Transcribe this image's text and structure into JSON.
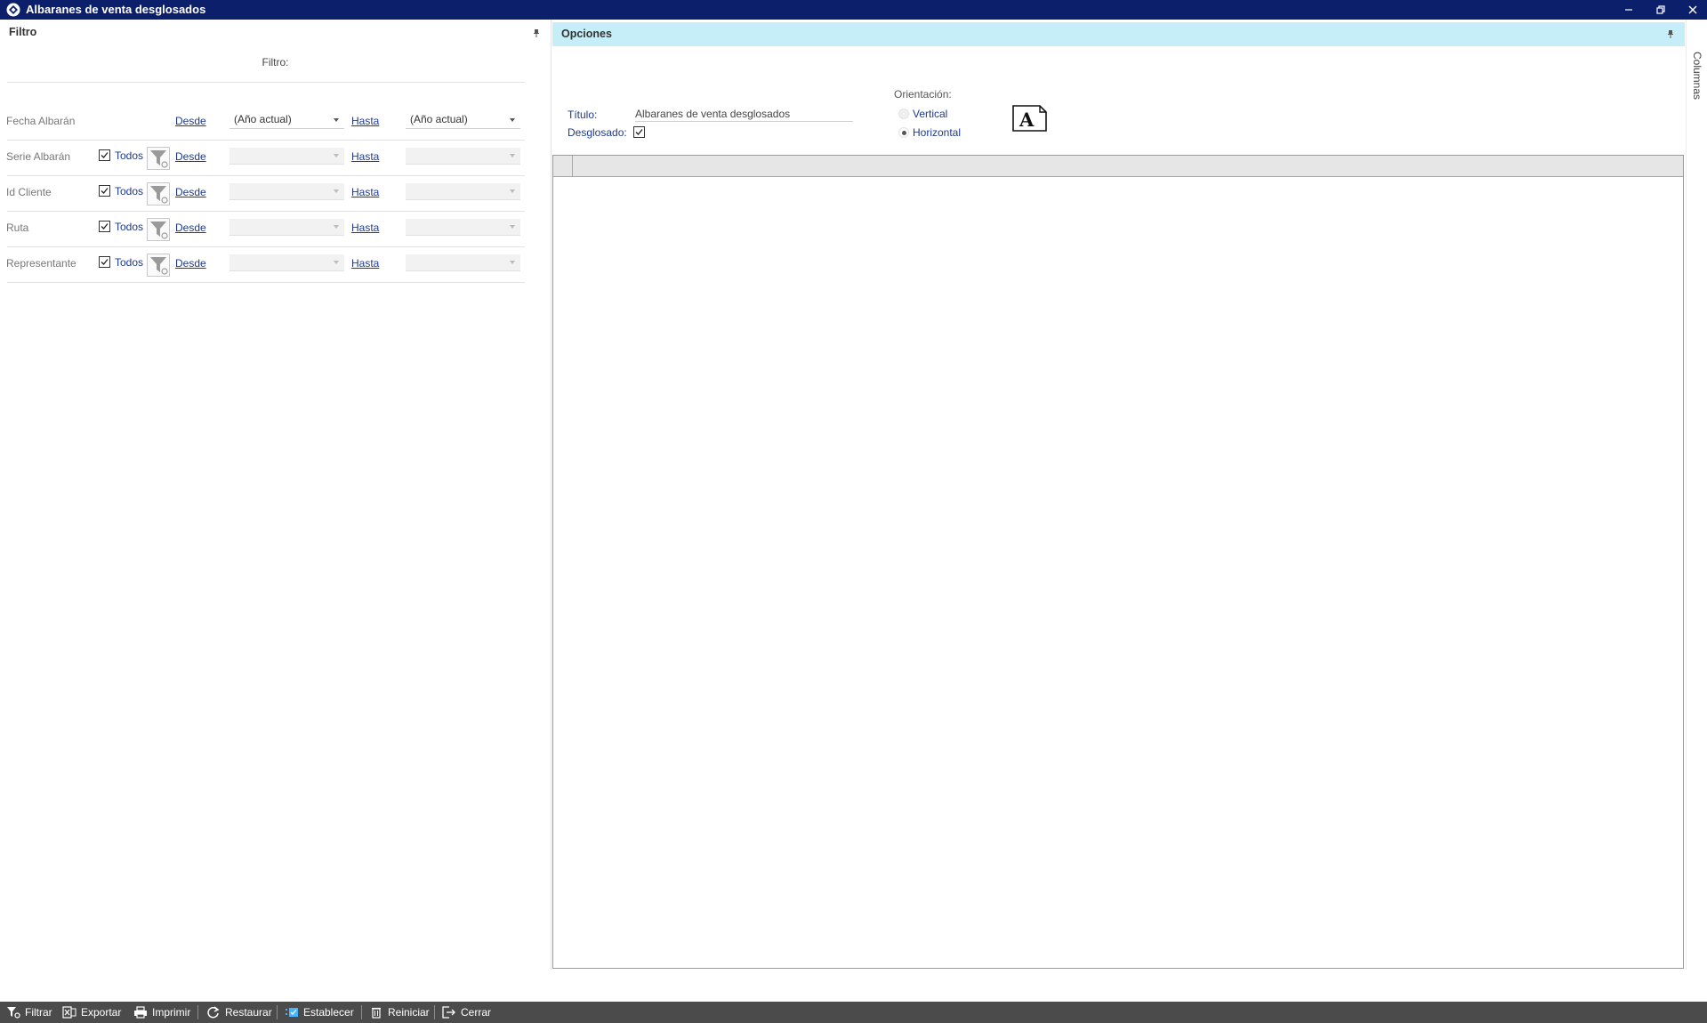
{
  "window": {
    "title": "Albaranes de venta desglosados",
    "controls": [
      "minimize",
      "restore",
      "close"
    ]
  },
  "filter_panel": {
    "header": "Filtro",
    "filter_label": "Filtro:",
    "rows": [
      {
        "label": "Fecha Albarán",
        "has_todos": false,
        "desde_link": "Desde",
        "desde_value": "(Año actual)",
        "hasta_link": "Hasta",
        "hasta_value": "(Año actual)"
      },
      {
        "label": "Serie Albarán",
        "has_todos": true,
        "todos_label": "Todos",
        "todos_checked": true,
        "desde_link": "Desde",
        "desde_value": "",
        "hasta_link": "Hasta",
        "hasta_value": ""
      },
      {
        "label": "Id Cliente",
        "has_todos": true,
        "todos_label": "Todos",
        "todos_checked": true,
        "desde_link": "Desde",
        "desde_value": "",
        "hasta_link": "Hasta",
        "hasta_value": ""
      },
      {
        "label": "Ruta",
        "has_todos": true,
        "todos_label": "Todos",
        "todos_checked": true,
        "desde_link": "Desde",
        "desde_value": "",
        "hasta_link": "Hasta",
        "hasta_value": ""
      },
      {
        "label": "Representante",
        "has_todos": true,
        "todos_label": "Todos",
        "todos_checked": true,
        "desde_link": "Desde",
        "hasta_link": "Hasta"
      }
    ]
  },
  "options_panel": {
    "header": "Opciones",
    "titulo_label": "Título:",
    "titulo_value": "Albaranes de venta desglosados",
    "desglosado_label": "Desglosado:",
    "desglosado_checked": true,
    "orientacion_label": "Orientación:",
    "orientation_options": [
      {
        "label": "Vertical",
        "selected": false
      },
      {
        "label": "Horizontal",
        "selected": true
      }
    ]
  },
  "side_tab": {
    "label": "Columnas"
  },
  "toolbar": {
    "buttons": [
      {
        "label": "Filtrar",
        "icon": "filter-icon"
      },
      {
        "label": "Exportar",
        "icon": "excel-icon"
      },
      {
        "label": "Imprimir",
        "icon": "printer-icon"
      },
      {
        "label": "Restaurar",
        "icon": "refresh-icon"
      },
      {
        "label": "Establecer",
        "icon": "set-layout-icon"
      },
      {
        "label": "Reiniciar",
        "icon": "trash-icon"
      },
      {
        "label": "Cerrar",
        "icon": "exit-icon"
      }
    ]
  },
  "colors": {
    "titlebar": "#0b1f6b",
    "options_header": "#c6eef9",
    "link": "#1f3a8a",
    "toolbar": "#4b4b4b"
  }
}
